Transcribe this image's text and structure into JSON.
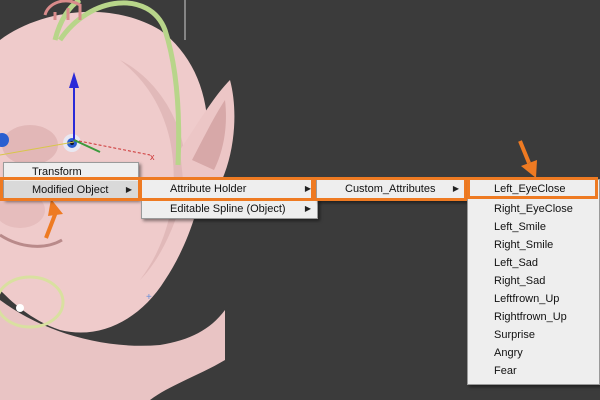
{
  "menu1": {
    "items": [
      {
        "label": "Transform",
        "has_submenu": false
      },
      {
        "label": "Modified Object",
        "has_submenu": true
      }
    ]
  },
  "menu2": {
    "items": [
      {
        "label": "Attribute Holder",
        "has_submenu": true
      },
      {
        "label": "Editable Spline (Object)",
        "has_submenu": true
      }
    ]
  },
  "menu3": {
    "items": [
      {
        "label": "Custom_Attributes",
        "has_submenu": true
      }
    ]
  },
  "menu4": {
    "items": [
      {
        "label": "Left_EyeClose"
      },
      {
        "label": "Right_EyeClose"
      },
      {
        "label": "Left_Smile"
      },
      {
        "label": "Right_Smile"
      },
      {
        "label": "Left_Sad"
      },
      {
        "label": "Right_Sad"
      },
      {
        "label": "Leftfrown_Up"
      },
      {
        "label": "Rightfrown_Up"
      },
      {
        "label": "Surprise"
      },
      {
        "label": "Angry"
      },
      {
        "label": "Fear"
      }
    ]
  },
  "colors": {
    "highlight": "#ee7a22",
    "menu_bg": "#eeeeee",
    "viewport_bg": "#3b3b3b",
    "skin": "#f0cfcf"
  },
  "icons": [
    "submenu-arrow-icon",
    "pointer-arrow-icon",
    "gizmo-icon"
  ]
}
